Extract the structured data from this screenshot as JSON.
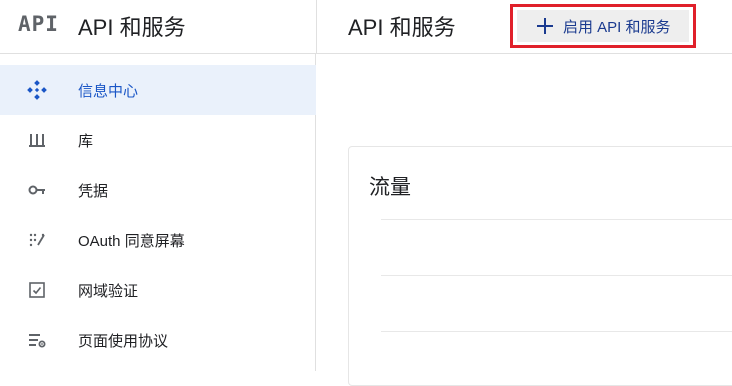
{
  "header": {
    "logo_text": "API",
    "product_title": "API 和服务",
    "page_title": "API 和服务",
    "enable_button_label": "启用 API 和服务"
  },
  "sidebar": {
    "items": [
      {
        "label": "信息中心",
        "icon": "dashboard-icon",
        "active": true
      },
      {
        "label": "库",
        "icon": "library-icon",
        "active": false
      },
      {
        "label": "凭据",
        "icon": "key-icon",
        "active": false
      },
      {
        "label": "OAuth 同意屏幕",
        "icon": "consent-screen-icon",
        "active": false
      },
      {
        "label": "网域验证",
        "icon": "checkbox-icon",
        "active": false
      },
      {
        "label": "页面使用协议",
        "icon": "settings-list-icon",
        "active": false
      }
    ]
  },
  "main": {
    "traffic_card_title": "流量"
  },
  "colors": {
    "accent": "#1a56c6",
    "active_bg": "#eaf1fb",
    "highlight_border": "#e0202a"
  }
}
